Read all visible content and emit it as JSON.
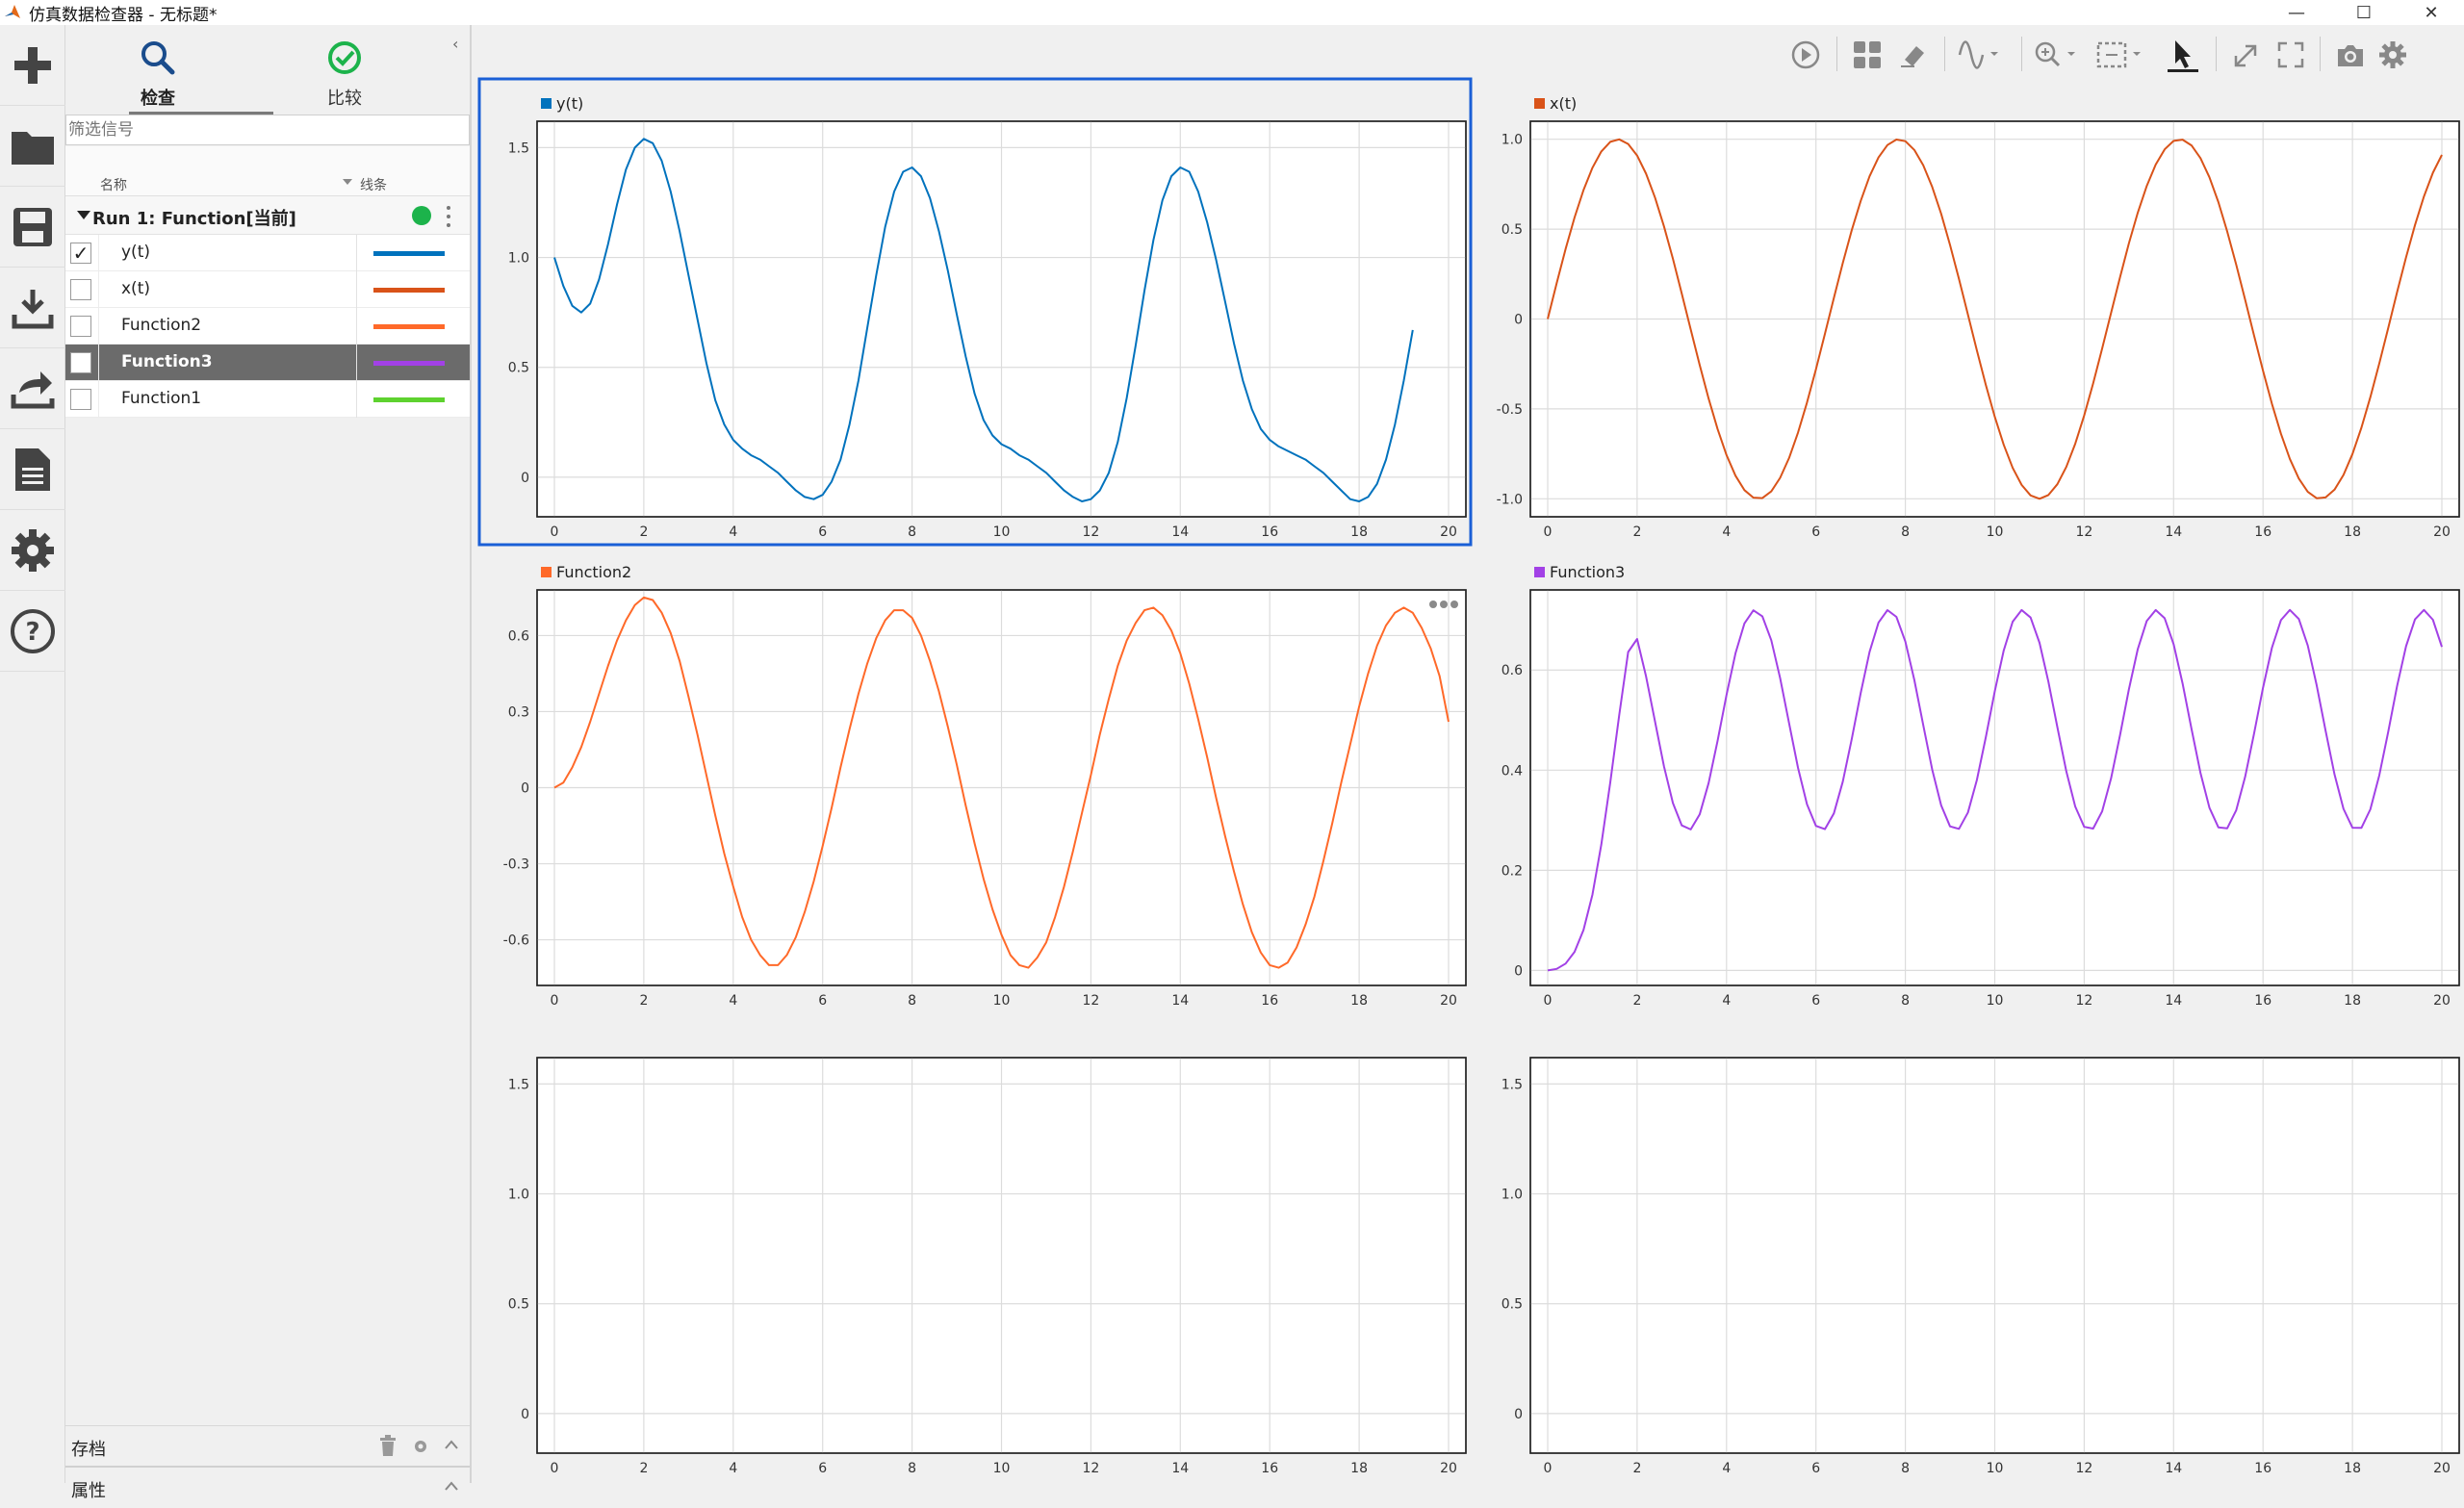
{
  "window": {
    "title": "仿真数据检查器 - 无标题*"
  },
  "colors": {
    "accent": "#1a5fd6",
    "y_t": "#0072bd",
    "x_t": "#d95319",
    "function2": "#ff6929",
    "function3": "#a241e6",
    "function1": "#5ed22f",
    "status_green": "#1cb34b"
  },
  "rail": {
    "items": [
      {
        "name": "new-icon"
      },
      {
        "name": "open-folder-icon"
      },
      {
        "name": "save-icon"
      },
      {
        "name": "import-icon"
      },
      {
        "name": "export-icon"
      },
      {
        "name": "report-icon"
      },
      {
        "name": "settings-icon"
      },
      {
        "name": "help-icon"
      }
    ]
  },
  "side": {
    "tabs": [
      {
        "label": "检查",
        "icon": "search-icon"
      },
      {
        "label": "比较",
        "icon": "check-circle-icon"
      }
    ],
    "filter_placeholder": "筛选信号",
    "columns": {
      "name": "名称",
      "line": "线条"
    },
    "run": {
      "label": "Run 1: Function[当前]"
    },
    "signals": [
      {
        "name": "y(t)",
        "checked": true,
        "color": "#0072bd",
        "selected": false
      },
      {
        "name": "x(t)",
        "checked": false,
        "color": "#d95319",
        "selected": false
      },
      {
        "name": "Function2",
        "checked": false,
        "color": "#ff6929",
        "selected": false
      },
      {
        "name": "Function3",
        "checked": false,
        "color": "#a241e6",
        "selected": true
      },
      {
        "name": "Function1",
        "checked": false,
        "color": "#5ed22f",
        "selected": false
      }
    ],
    "archive_label": "存档",
    "properties_label": "属性"
  },
  "toolbar": {
    "icons": [
      "play-icon",
      "layout-grid-icon",
      "eraser-icon",
      "signal-wave-icon",
      "zoom-in-icon",
      "fit-region-icon",
      "cursor-icon",
      "expand-icon",
      "fullscreen-icon",
      "camera-icon",
      "gear-icon"
    ]
  },
  "chart_data": [
    {
      "type": "line",
      "title": "",
      "legend": "y(t)",
      "color": "#0072bd",
      "selected": true,
      "xlim": [
        0,
        20
      ],
      "ylim": [
        -0.18,
        1.62
      ],
      "xticks": [
        "0",
        "2",
        "4",
        "6",
        "8",
        "10",
        "12",
        "14",
        "16",
        "18",
        "20"
      ],
      "yticks": [
        {
          "v": 1.5,
          "l": "1.5"
        },
        {
          "v": 1.0,
          "l": "1.0"
        },
        {
          "v": 0.5,
          "l": "0.5"
        },
        {
          "v": 0,
          "l": "0"
        }
      ],
      "x": [
        0,
        0.2,
        0.4,
        0.6,
        0.8,
        1.0,
        1.2,
        1.4,
        1.6,
        1.8,
        2.0,
        2.2,
        2.4,
        2.6,
        2.8,
        3.0,
        3.2,
        3.4,
        3.6,
        3.8,
        4.0,
        4.2,
        4.4,
        4.6,
        4.8,
        5.0,
        5.2,
        5.4,
        5.6,
        5.8,
        6.0,
        6.2,
        6.4,
        6.6,
        6.8,
        7.0,
        7.2,
        7.4,
        7.6,
        7.8,
        8.0,
        8.2,
        8.4,
        8.6,
        8.8,
        9.0,
        9.2,
        9.4,
        9.6,
        9.8,
        10.0,
        10.2,
        10.4,
        10.6,
        10.8,
        11.0,
        11.2,
        11.4,
        11.6,
        11.8,
        12.0,
        12.2,
        12.4,
        12.6,
        12.8,
        13.0,
        13.2,
        13.4,
        13.6,
        13.8,
        14.0,
        14.2,
        14.4,
        14.6,
        14.8,
        15.0,
        15.2,
        15.4,
        15.6,
        15.8,
        16.0,
        16.2,
        16.4,
        16.6,
        16.8,
        17.0,
        17.2,
        17.4,
        17.6,
        17.8,
        18.0,
        18.2,
        18.4,
        18.6,
        18.8,
        19.0,
        19.2,
        19.4,
        19.6,
        19.8,
        20.0
      ],
      "y": [
        1.0,
        0.87,
        0.78,
        0.75,
        0.79,
        0.9,
        1.06,
        1.24,
        1.4,
        1.5,
        1.54,
        1.52,
        1.44,
        1.3,
        1.12,
        0.92,
        0.72,
        0.52,
        0.35,
        0.24,
        0.17,
        0.13,
        0.1,
        0.08,
        0.05,
        0.02,
        -0.02,
        -0.06,
        -0.09,
        -0.1,
        -0.08,
        -0.02,
        0.08,
        0.24,
        0.44,
        0.68,
        0.92,
        1.14,
        1.3,
        1.39,
        1.41,
        1.37,
        1.27,
        1.12,
        0.94,
        0.74,
        0.55,
        0.38,
        0.26,
        0.19,
        0.15,
        0.13,
        0.1,
        0.08,
        0.05,
        0.02,
        -0.02,
        -0.06,
        -0.09,
        -0.11,
        -0.1,
        -0.06,
        0.02,
        0.16,
        0.36,
        0.6,
        0.85,
        1.08,
        1.26,
        1.37,
        1.41,
        1.39,
        1.3,
        1.16,
        0.99,
        0.8,
        0.61,
        0.44,
        0.31,
        0.22,
        0.17,
        0.14,
        0.12,
        0.1,
        0.08,
        0.05,
        0.02,
        -0.02,
        -0.06,
        -0.1,
        -0.11,
        -0.09,
        -0.03,
        0.08,
        0.24,
        0.44,
        0.67
      ]
    },
    {
      "type": "line",
      "title": "",
      "legend": "x(t)",
      "color": "#d95319",
      "selected": false,
      "xlim": [
        0,
        20
      ],
      "ylim": [
        -1.1,
        1.1
      ],
      "xticks": [
        "0",
        "2",
        "4",
        "6",
        "8",
        "10",
        "12",
        "14",
        "16",
        "18",
        "20"
      ],
      "yticks": [
        {
          "v": 1.0,
          "l": "1.0"
        },
        {
          "v": 0.5,
          "l": "0.5"
        },
        {
          "v": 0,
          "l": "0"
        },
        {
          "v": -0.5,
          "l": "-0.5"
        },
        {
          "v": -1.0,
          "l": "-1.0"
        }
      ],
      "function": "sin(x)"
    },
    {
      "type": "line",
      "title": "",
      "legend": "Function2",
      "color": "#ff6929",
      "selected": false,
      "xlim": [
        0,
        20
      ],
      "ylim": [
        -0.78,
        0.78
      ],
      "xticks": [
        "0",
        "2",
        "4",
        "6",
        "8",
        "10",
        "12",
        "14",
        "16",
        "18",
        "20"
      ],
      "yticks": [
        {
          "v": 0.6,
          "l": "0.6"
        },
        {
          "v": 0.3,
          "l": "0.3"
        },
        {
          "v": 0,
          "l": "0"
        },
        {
          "v": -0.3,
          "l": "-0.3"
        },
        {
          "v": -0.6,
          "l": "-0.6"
        }
      ],
      "x": [
        0,
        0.2,
        0.4,
        0.6,
        0.8,
        1.0,
        1.2,
        1.4,
        1.6,
        1.8,
        2.0,
        2.2,
        2.4,
        2.6,
        2.8,
        3.0,
        3.2,
        3.4,
        3.6,
        3.8,
        4.0,
        4.2,
        4.4,
        4.6,
        4.8,
        5.0,
        5.2,
        5.4,
        5.6,
        5.8,
        6.0,
        6.2,
        6.4,
        6.6,
        6.8,
        7.0,
        7.2,
        7.4,
        7.6,
        7.8,
        8.0,
        8.2,
        8.4,
        8.6,
        8.8,
        9.0,
        9.2,
        9.4,
        9.6,
        9.8,
        10.0,
        10.2,
        10.4,
        10.6,
        10.8,
        11.0,
        11.2,
        11.4,
        11.6,
        11.8,
        12.0,
        12.2,
        12.4,
        12.6,
        12.8,
        13.0,
        13.2,
        13.4,
        13.6,
        13.8,
        14.0,
        14.2,
        14.4,
        14.6,
        14.8,
        15.0,
        15.2,
        15.4,
        15.6,
        15.8,
        16.0,
        16.2,
        16.4,
        16.6,
        16.8,
        17.0,
        17.2,
        17.4,
        17.6,
        17.8,
        18.0,
        18.2,
        18.4,
        18.6,
        18.8,
        19.0,
        19.2,
        19.4,
        19.6,
        19.8,
        20.0
      ],
      "y": [
        0.0,
        0.02,
        0.08,
        0.16,
        0.26,
        0.37,
        0.48,
        0.58,
        0.66,
        0.72,
        0.75,
        0.74,
        0.69,
        0.61,
        0.5,
        0.36,
        0.21,
        0.05,
        -0.11,
        -0.26,
        -0.39,
        -0.51,
        -0.6,
        -0.66,
        -0.7,
        -0.7,
        -0.66,
        -0.59,
        -0.49,
        -0.37,
        -0.23,
        -0.08,
        0.08,
        0.23,
        0.37,
        0.49,
        0.59,
        0.66,
        0.7,
        0.7,
        0.67,
        0.6,
        0.5,
        0.38,
        0.24,
        0.09,
        -0.07,
        -0.22,
        -0.36,
        -0.48,
        -0.58,
        -0.66,
        -0.7,
        -0.71,
        -0.67,
        -0.61,
        -0.51,
        -0.39,
        -0.25,
        -0.1,
        0.05,
        0.21,
        0.35,
        0.48,
        0.58,
        0.65,
        0.7,
        0.71,
        0.68,
        0.62,
        0.53,
        0.41,
        0.27,
        0.12,
        -0.04,
        -0.19,
        -0.33,
        -0.46,
        -0.57,
        -0.65,
        -0.7,
        -0.71,
        -0.69,
        -0.63,
        -0.54,
        -0.43,
        -0.29,
        -0.14,
        0.02,
        0.17,
        0.32,
        0.45,
        0.56,
        0.64,
        0.69,
        0.71,
        0.69,
        0.63,
        0.55,
        0.44,
        0.26
      ]
    },
    {
      "type": "line",
      "title": "",
      "legend": "Function3",
      "color": "#a241e6",
      "selected": false,
      "xlim": [
        0,
        20
      ],
      "ylim": [
        -0.03,
        0.76
      ],
      "xticks": [
        "0",
        "2",
        "4",
        "6",
        "8",
        "10",
        "12",
        "14",
        "16",
        "18",
        "20"
      ],
      "yticks": [
        {
          "v": 0.6,
          "l": "0.6"
        },
        {
          "v": 0.4,
          "l": "0.4"
        },
        {
          "v": 0.2,
          "l": "0.2"
        },
        {
          "v": 0,
          "l": "0"
        }
      ],
      "function": "0.5 - 0.22*cos(2.1x), ramp-up start"
    },
    {
      "type": "line",
      "title": "",
      "legend": "",
      "color": "",
      "selected": false,
      "xlim": [
        0,
        20
      ],
      "ylim": [
        -0.18,
        1.62
      ],
      "xticks": [
        "0",
        "2",
        "4",
        "6",
        "8",
        "10",
        "12",
        "14",
        "16",
        "18",
        "20"
      ],
      "yticks": [
        {
          "v": 1.5,
          "l": "1.5"
        },
        {
          "v": 1.0,
          "l": "1.0"
        },
        {
          "v": 0.5,
          "l": "0.5"
        },
        {
          "v": 0,
          "l": "0"
        }
      ]
    },
    {
      "type": "line",
      "title": "",
      "legend": "",
      "color": "",
      "selected": false,
      "xlim": [
        0,
        20
      ],
      "ylim": [
        -0.18,
        1.62
      ],
      "xticks": [
        "0",
        "2",
        "4",
        "6",
        "8",
        "10",
        "12",
        "14",
        "16",
        "18",
        "20"
      ],
      "yticks": [
        {
          "v": 1.5,
          "l": "1.5"
        },
        {
          "v": 1.0,
          "l": "1.0"
        },
        {
          "v": 0.5,
          "l": "0.5"
        },
        {
          "v": 0,
          "l": "0"
        }
      ]
    }
  ]
}
